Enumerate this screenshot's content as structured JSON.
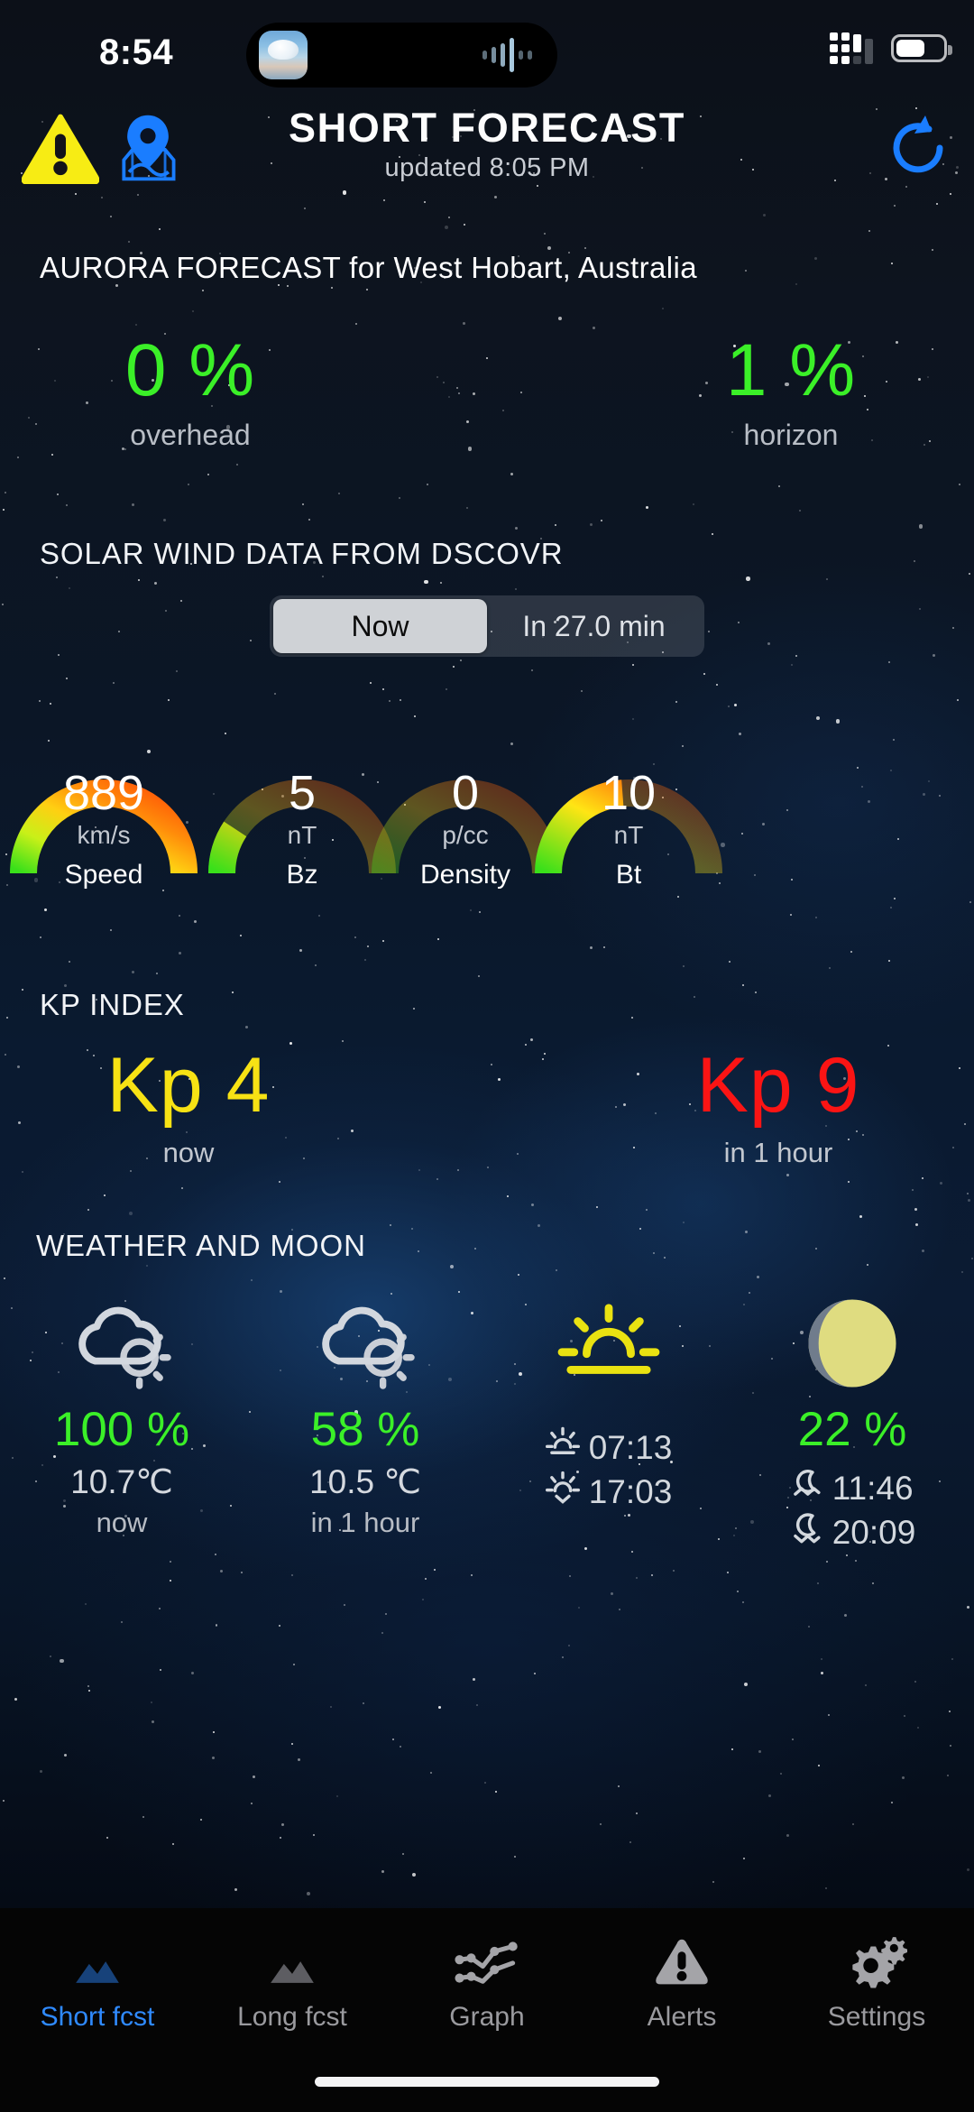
{
  "statusbar": {
    "time": "8:54",
    "app_icon": "cloud-photo-icon",
    "audio_icon": "audio-waveform-icon",
    "signal_icon": "cellular-signal-icon",
    "battery_icon": "battery-icon",
    "battery_level": 62
  },
  "header": {
    "warning_icon": "warning-triangle-icon",
    "location_icon": "map-pin-icon",
    "refresh_icon": "refresh-icon",
    "title": "SHORT FORECAST",
    "subtitle": "updated  8:05 PM",
    "warning_color": "#f7ec14",
    "accent_color": "#1a7dff"
  },
  "aurora": {
    "label_prefix": "AURORA FORECAST for",
    "location": "West Hobart, Australia",
    "full_line": "AURORA FORECAST for  West Hobart, Australia",
    "value_color": "#3bf028",
    "items": [
      {
        "value": "0 %",
        "caption": "overhead"
      },
      {
        "value": "1 %",
        "caption": "horizon"
      }
    ]
  },
  "solar_wind": {
    "title": "SOLAR WIND DATA FROM DSCOVR",
    "segments": [
      {
        "label": "Now",
        "selected": true
      },
      {
        "label": "In 27.0 min",
        "selected": false
      }
    ],
    "gauges": [
      {
        "value": "889",
        "unit": "km/s",
        "label": "Speed",
        "fill": 0.72
      },
      {
        "value": "5",
        "unit": "nT",
        "label": "Bz",
        "fill": 0.1
      },
      {
        "value": "0",
        "unit": "p/cc",
        "label": "Density",
        "fill": 0.0
      },
      {
        "value": "10",
        "unit": "nT",
        "label": "Bt",
        "fill": 0.26
      }
    ]
  },
  "kp_index": {
    "title": "KP INDEX",
    "items": [
      {
        "value": "Kp 4",
        "caption": "now",
        "color": "#f7e214"
      },
      {
        "value": "Kp 9",
        "caption": "in 1 hour",
        "color": "#fb1414"
      }
    ]
  },
  "weather_moon": {
    "title": "WEATHER AND MOON",
    "cloud_now": {
      "icon": "cloud-sun-icon",
      "percent": "100 %",
      "temp": "10.7℃",
      "when": "now"
    },
    "cloud_next": {
      "icon": "cloud-sun-icon",
      "percent": "58 %",
      "temp": "10.5 ℃",
      "when": "in 1 hour"
    },
    "sun": {
      "icon": "sunrise-icon",
      "rise_icon": "sunrise-small-icon",
      "rise": "07:13",
      "set_icon": "sunset-small-icon",
      "set": "17:03"
    },
    "moon": {
      "icon": "moon-phase-icon",
      "illumination": "22 %",
      "rise_icon": "moonrise-icon",
      "rise": "11:46",
      "set_icon": "moonset-icon",
      "set": "20:09",
      "lit_color": "#dfdc80",
      "dark_color": "#707c8c"
    }
  },
  "tabbar": {
    "active_color": "#2f8aff",
    "inactive_color": "#9a9a9e",
    "tabs": [
      {
        "label": "Short fcst",
        "icon": "aurora-mountain-icon",
        "active": true
      },
      {
        "label": "Long fcst",
        "icon": "aurora-mountain-icon",
        "active": false
      },
      {
        "label": "Graph",
        "icon": "line-chart-icon",
        "active": false
      },
      {
        "label": "Alerts",
        "icon": "warning-triangle-icon",
        "active": false
      },
      {
        "label": "Settings",
        "icon": "gears-icon",
        "active": false
      }
    ]
  }
}
